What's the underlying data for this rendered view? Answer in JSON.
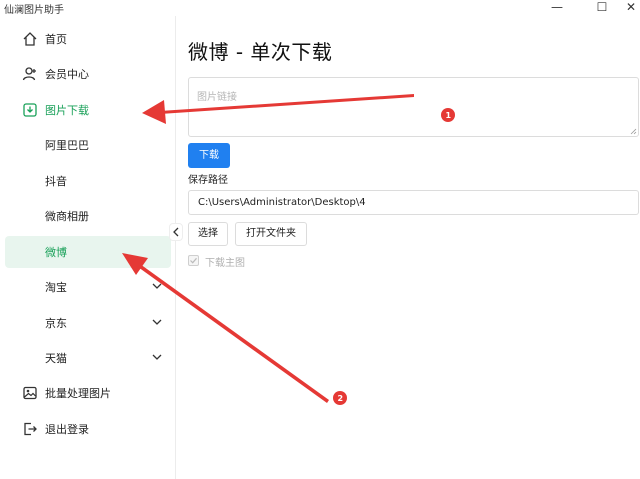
{
  "window": {
    "title": "仙澜图片助手",
    "min_glyph": "—",
    "max_glyph": "☐",
    "close_glyph": "✕"
  },
  "sidebar": {
    "items": [
      {
        "label": "首页",
        "icon": "home-icon"
      },
      {
        "label": "会员中心",
        "icon": "user-add-icon"
      },
      {
        "label": "图片下载",
        "icon": "download-icon",
        "state": "active-parent"
      },
      {
        "label": "阿里巴巴"
      },
      {
        "label": "抖音"
      },
      {
        "label": "微商相册"
      },
      {
        "label": "微博",
        "state": "selected"
      },
      {
        "label": "淘宝",
        "expandable": true
      },
      {
        "label": "京东",
        "expandable": true
      },
      {
        "label": "天猫",
        "expandable": true
      },
      {
        "label": "批量处理图片",
        "icon": "image-icon"
      },
      {
        "label": "退出登录",
        "icon": "logout-icon"
      }
    ]
  },
  "main": {
    "title": "微博 - 单次下载",
    "link_placeholder": "图片链接",
    "download_label": "下载",
    "path_label": "保存路径",
    "path_value": "C:\\Users\\Administrator\\Desktop\\4",
    "select_label": "选择",
    "open_folder_label": "打开文件夹",
    "checkbox_label": "下载主图",
    "checkbox_checked": true,
    "checkbox_disabled": true
  },
  "annotations": {
    "badges": [
      "1",
      "2"
    ],
    "arrow_color": "#e53935"
  },
  "colors": {
    "accent_green": "#18a058",
    "selected_bg": "#e8f5ee",
    "primary_blue": "#2080f0"
  }
}
